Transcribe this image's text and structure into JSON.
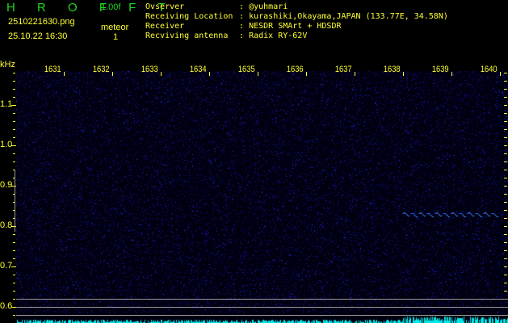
{
  "app": {
    "name": "H R O F F T",
    "version": "1.00f"
  },
  "file": {
    "name": "2510221630.png",
    "datetime": "25.10.22 16:30"
  },
  "meteor": {
    "label": "meteor",
    "count": "1"
  },
  "info": [
    {
      "label": "Ovserver",
      "sep": ":",
      "value": "@yuhmari"
    },
    {
      "label": "Receiving Location",
      "sep": ":",
      "value": "kurashiki,Okayama,JAPAN (133.77E, 34.58N)"
    },
    {
      "label": "Receiver",
      "sep": ":",
      "value": "NESDR SMArt + HDSDR"
    },
    {
      "label": "Recviving antenna",
      "sep": ":",
      "value": "Radix RY-62V"
    }
  ],
  "y_axis": {
    "unit": "kHz",
    "ticks": [
      "1.1",
      "1.0",
      "0.9",
      "0.8",
      "0.7",
      "0.6"
    ]
  },
  "x_axis": {
    "ticks": [
      "1631",
      "1632",
      "1633",
      "1634",
      "1635",
      "1636",
      "1637",
      "1638",
      "1639",
      "1640"
    ]
  },
  "colors": {
    "text": "#ffff33",
    "logo": "#1ed81e",
    "noise": "#1a1ad0",
    "echo": "#3aa0ff",
    "histogram": "#00e8e8",
    "guide_lines": "#9a9a9a"
  }
}
